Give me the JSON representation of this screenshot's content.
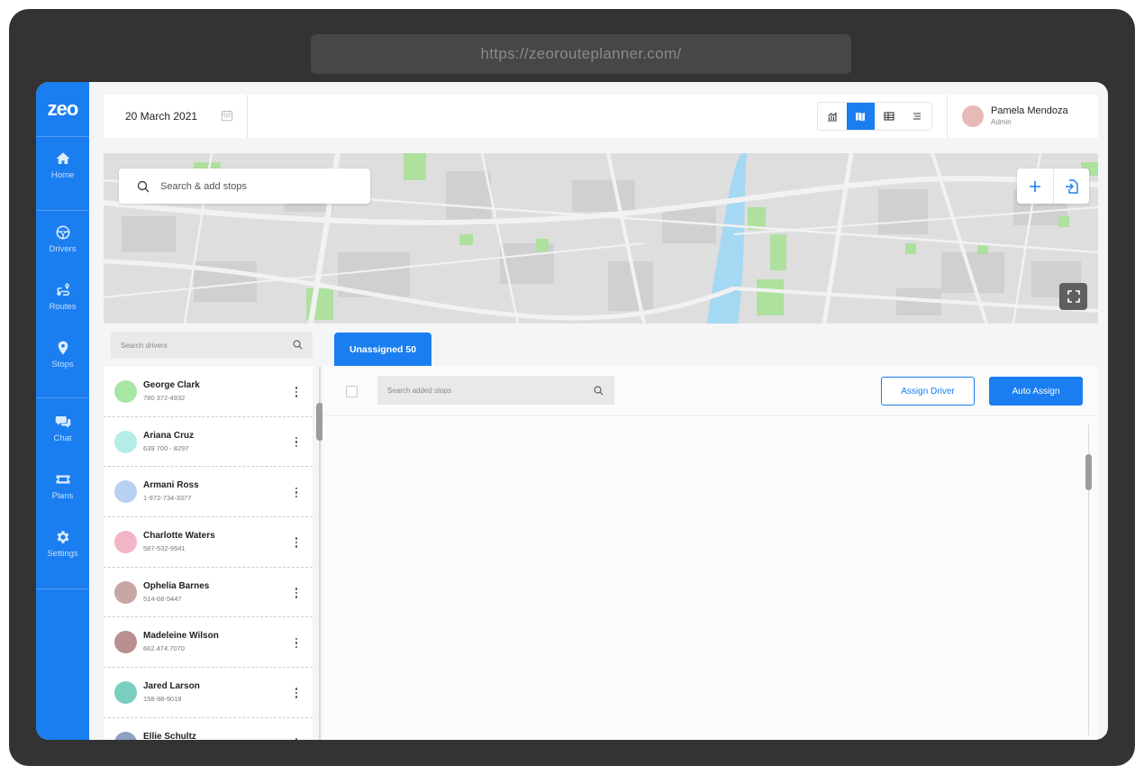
{
  "browser": {
    "url": "https://zeorouteplanner.com/"
  },
  "app": {
    "logo": "zeo"
  },
  "sidebar": {
    "items": [
      {
        "label": "Home",
        "icon": "home-icon"
      },
      {
        "label": "Drivers",
        "icon": "steering-wheel-icon"
      },
      {
        "label": "Routes",
        "icon": "route-icon"
      },
      {
        "label": "Stops",
        "icon": "map-pin-icon"
      },
      {
        "label": "Chat",
        "icon": "chat-icon"
      },
      {
        "label": "Plans",
        "icon": "ticket-icon"
      },
      {
        "label": "Settings",
        "icon": "gear-icon"
      }
    ]
  },
  "header": {
    "date": "20 March 2021",
    "views": [
      "chart-view-icon",
      "map-view-icon",
      "table-view-icon",
      "list-view-icon"
    ],
    "active_view": "map",
    "user": {
      "name": "Pamela Mendoza",
      "role": "Admin"
    }
  },
  "map": {
    "search_placeholder": "Search & add stops"
  },
  "drivers": {
    "search_placeholder": "Search drivers",
    "list": [
      {
        "name": "George Clark",
        "phone": "780 372-4932",
        "color": "#a8e6a3"
      },
      {
        "name": "Ariana Cruz",
        "phone": "639 700 -  8297",
        "color": "#b4ece7"
      },
      {
        "name": "Armani Ross",
        "phone": "1-972-734-3377",
        "color": "#b8d0f2"
      },
      {
        "name": "Charlotte Waters",
        "phone": "587-532-9541",
        "color": "#f2b5c6"
      },
      {
        "name": "Ophelia Barnes",
        "phone": "514-68-5447",
        "color": "#c7a6a3"
      },
      {
        "name": "Madeleine Wilson",
        "phone": "662.474.7070",
        "color": "#b98f90"
      },
      {
        "name": "Jared Larson",
        "phone": "158-98-9018",
        "color": "#78cfc0"
      },
      {
        "name": "Ellie Schultz",
        "phone": "",
        "color": "#8fa0c2"
      }
    ]
  },
  "stops": {
    "tab_label": "Unassigned 50",
    "search_placeholder": "Search added stops",
    "assign_driver_label": "Assign Driver",
    "auto_assign_label": "Auto Assign"
  },
  "colors": {
    "accent": "#1a7ef0"
  }
}
